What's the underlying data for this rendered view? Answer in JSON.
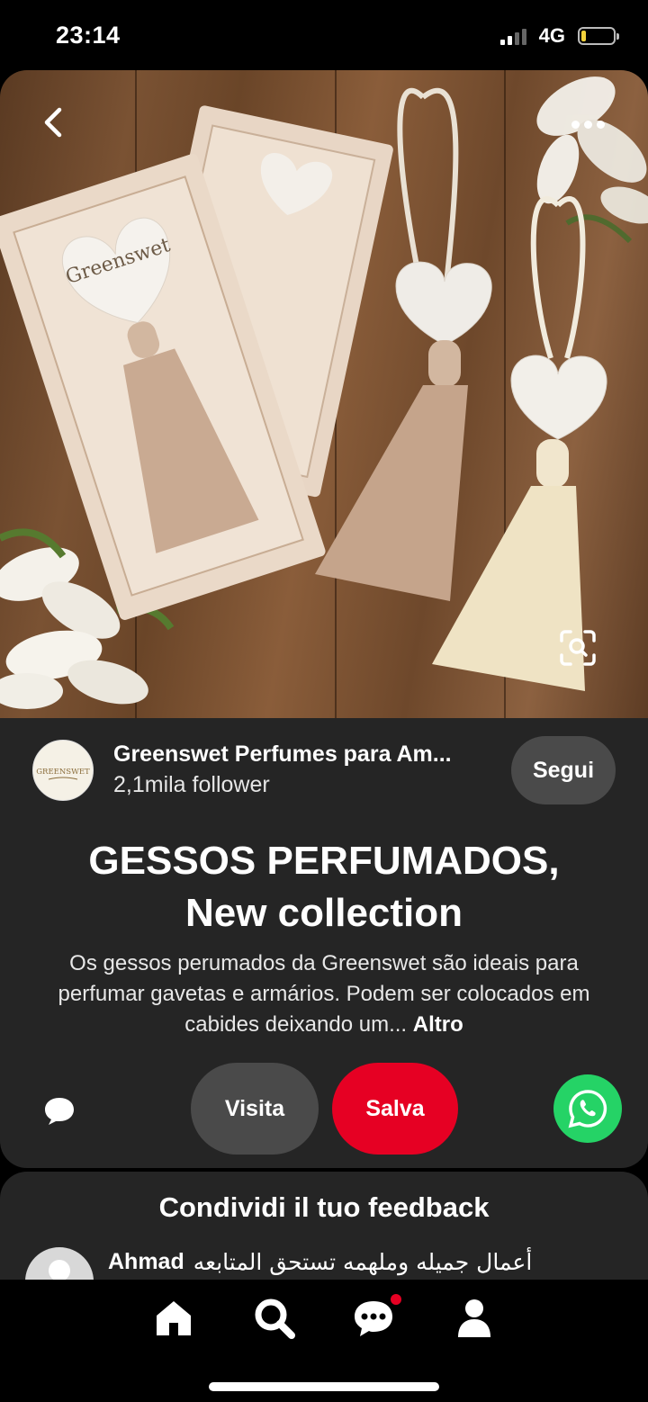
{
  "status_bar": {
    "time": "23:14",
    "network": "4G",
    "battery_level": 0.15,
    "signal_bars": 2
  },
  "hero": {
    "back_icon": "chevron-left-icon",
    "more_icon": "more-horizontal-icon",
    "lens_icon": "visual-search-icon",
    "box_brand": "Greenswet"
  },
  "pin": {
    "author_name": "Greenswet Perfumes para Am...",
    "author_logo_text": "GREENSWET",
    "followers": "2,1mila follower",
    "follow_label": "Segui",
    "title_line1": "GESSOS PERFUMADOS,",
    "title_line2": "New collection",
    "description": "Os gessos perumados da Greenswet são ideais para perfumar gavetas e armários. Podem ser colocados em cabides deixando um...",
    "more_label": "Altro",
    "visit_label": "Visita",
    "save_label": "Salva",
    "comment_icon": "comment-icon",
    "share_icon": "whatsapp-icon"
  },
  "feedback": {
    "title": "Condividi il tuo feedback",
    "user": "Ahmad",
    "comment": "أعمال جميله وملهمه تستحق المتابعه"
  },
  "nav": {
    "items": [
      "home-icon",
      "search-icon",
      "messages-icon",
      "profile-icon"
    ],
    "active": "search-icon"
  },
  "colors": {
    "save": "#e60023",
    "whatsapp": "#25d366",
    "card_bg": "#252525",
    "button_gray": "#4a4a4a"
  }
}
